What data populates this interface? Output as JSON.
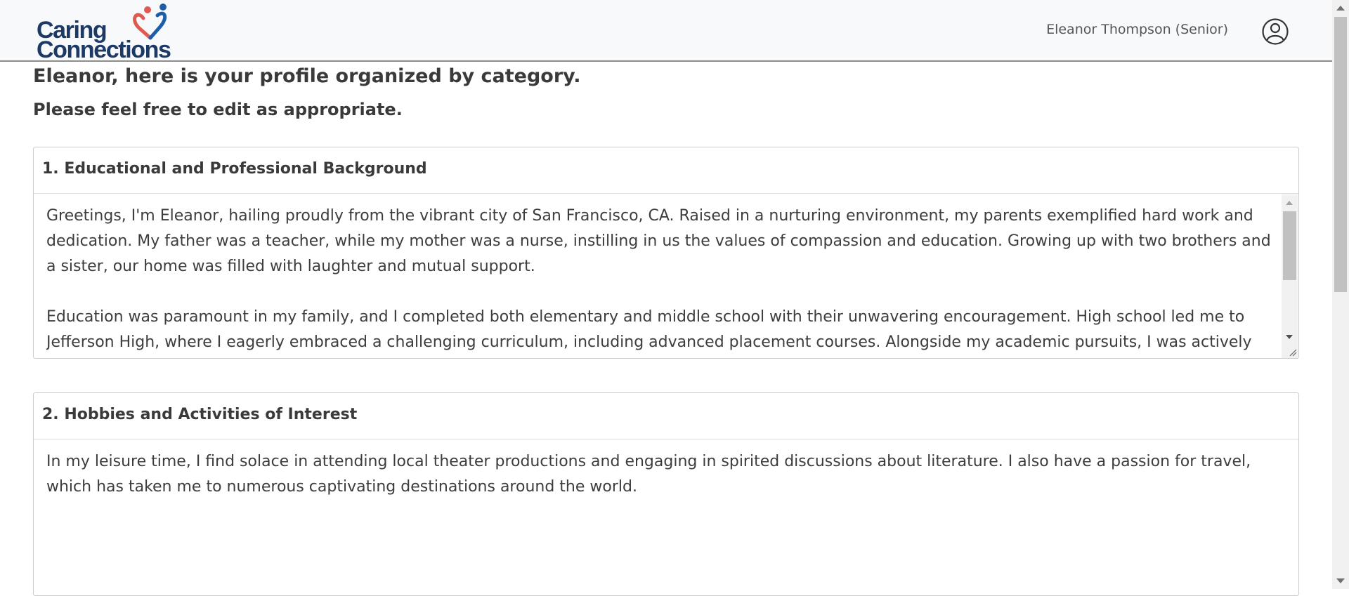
{
  "header": {
    "logo_line1": "Caring",
    "logo_line2": "Connections",
    "user_name": "Eleanor Thompson (Senior)",
    "icons": {
      "avatar": "user-circle-icon",
      "logo": "heart-people-icon"
    },
    "colors": {
      "logo_text": "#1d3a66",
      "heart_red": "#e05a4f",
      "heart_blue": "#1d5ea8"
    }
  },
  "main": {
    "title": "Eleanor, here is your profile organized by category.",
    "subtitle": "Please feel free to edit as appropriate.",
    "sections": [
      {
        "heading": "1. Educational and Professional Background",
        "text": "Greetings, I'm Eleanor, hailing proudly from the vibrant city of San Francisco, CA. Raised in a nurturing environment, my parents exemplified hard work and dedication. My father was a teacher, while my mother was a nurse, instilling in us the values of compassion and education. Growing up with two brothers and a sister, our home was filled with laughter and mutual support.\n\nEducation was paramount in my family, and I completed both elementary and middle school with their unwavering encouragement. High school led me to Jefferson High, where I eagerly embraced a challenging curriculum, including advanced placement courses. Alongside my academic pursuits, I was actively involved in the"
      },
      {
        "heading": "2. Hobbies and Activities of Interest",
        "text": "In my leisure time, I find solace in attending local theater productions and engaging in spirited discussions about literature. I also have a passion for travel, which has taken me to numerous captivating destinations around the world."
      }
    ]
  }
}
